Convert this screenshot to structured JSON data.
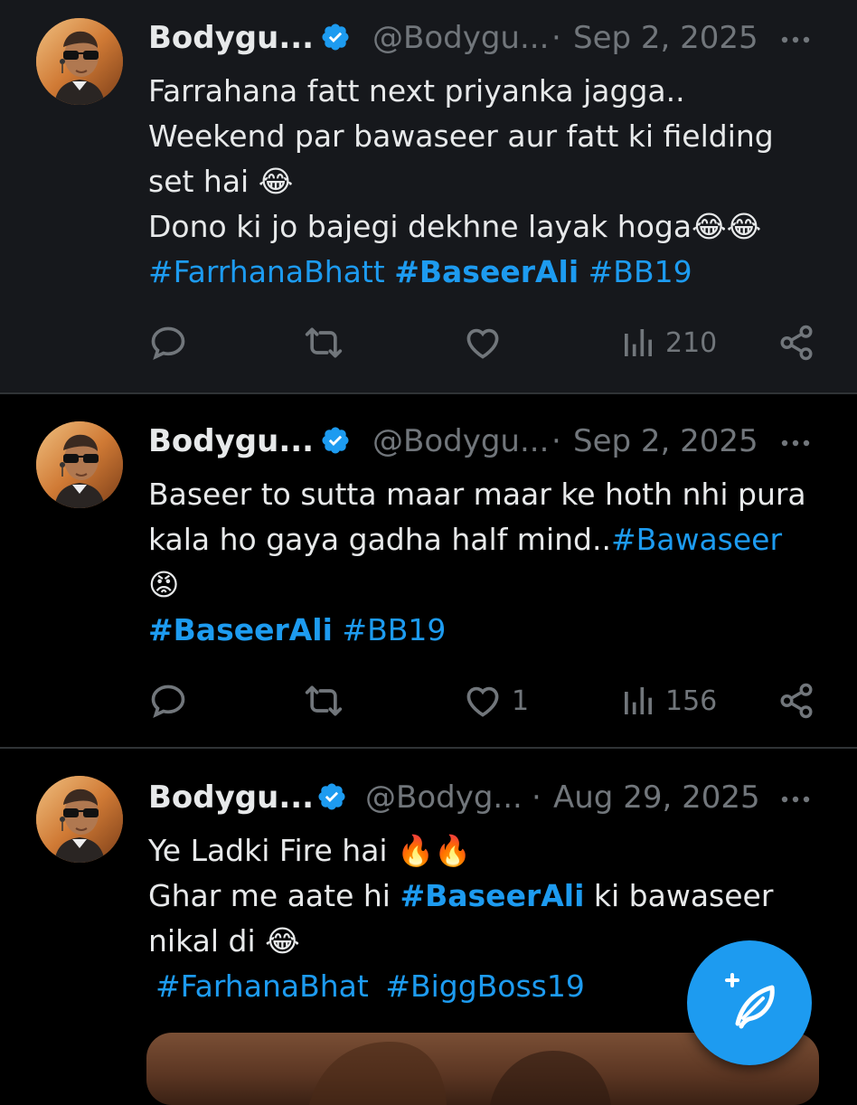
{
  "tweets": [
    {
      "name": "Bodygu...",
      "handle": "@Bodygu...",
      "separator": "·",
      "date": "Sep 2, 2025",
      "text_lines": [
        "Farrahana fatt next priyanka jagga..",
        "Weekend par bawaseer aur fatt ki fielding",
        "set hai 😂",
        "Dono ki jo bajegi dekhne layak hoga😂😂"
      ],
      "hashtags": [
        "#FarrhanaBhatt",
        "#BaseerAli",
        "#BB19"
      ],
      "likes": "",
      "views": "210"
    },
    {
      "name": "Bodygu...",
      "handle": "@Bodygu...",
      "separator": "·",
      "date": "Sep 2, 2025",
      "text_lines": [
        "Baseer to sutta maar maar ke hoth nhi pura",
        "kala ho gaya gadha half mind..",
        "😡"
      ],
      "inline_tag": "#Bawaseer",
      "hashtags": [
        "#BaseerAli",
        "#BB19"
      ],
      "likes": "1",
      "views": "156"
    },
    {
      "name": "Bodygu...",
      "handle": "@Bodyg...",
      "separator": "·",
      "date": "Aug 29, 2025",
      "text_lines": [
        "Ye Ladki Fire hai 🔥🔥",
        "Ghar me aate hi",
        "ki bawaseer",
        "nikal di 😂"
      ],
      "inline_tag": "#BaseerAli",
      "hashtags": [
        "#FarhanaBhat",
        "#BiggBoss19"
      ]
    }
  ],
  "icons": {
    "verified": "verified-badge-icon",
    "more": "more-options-icon",
    "reply": "reply-icon",
    "retweet": "retweet-icon",
    "like": "like-icon",
    "views": "views-icon",
    "share": "share-icon",
    "compose": "compose-post-icon"
  },
  "colors": {
    "accent": "#1d9bf0",
    "text": "#e7e9ea",
    "muted": "#71767b",
    "highlight_bg": "#16181c"
  }
}
